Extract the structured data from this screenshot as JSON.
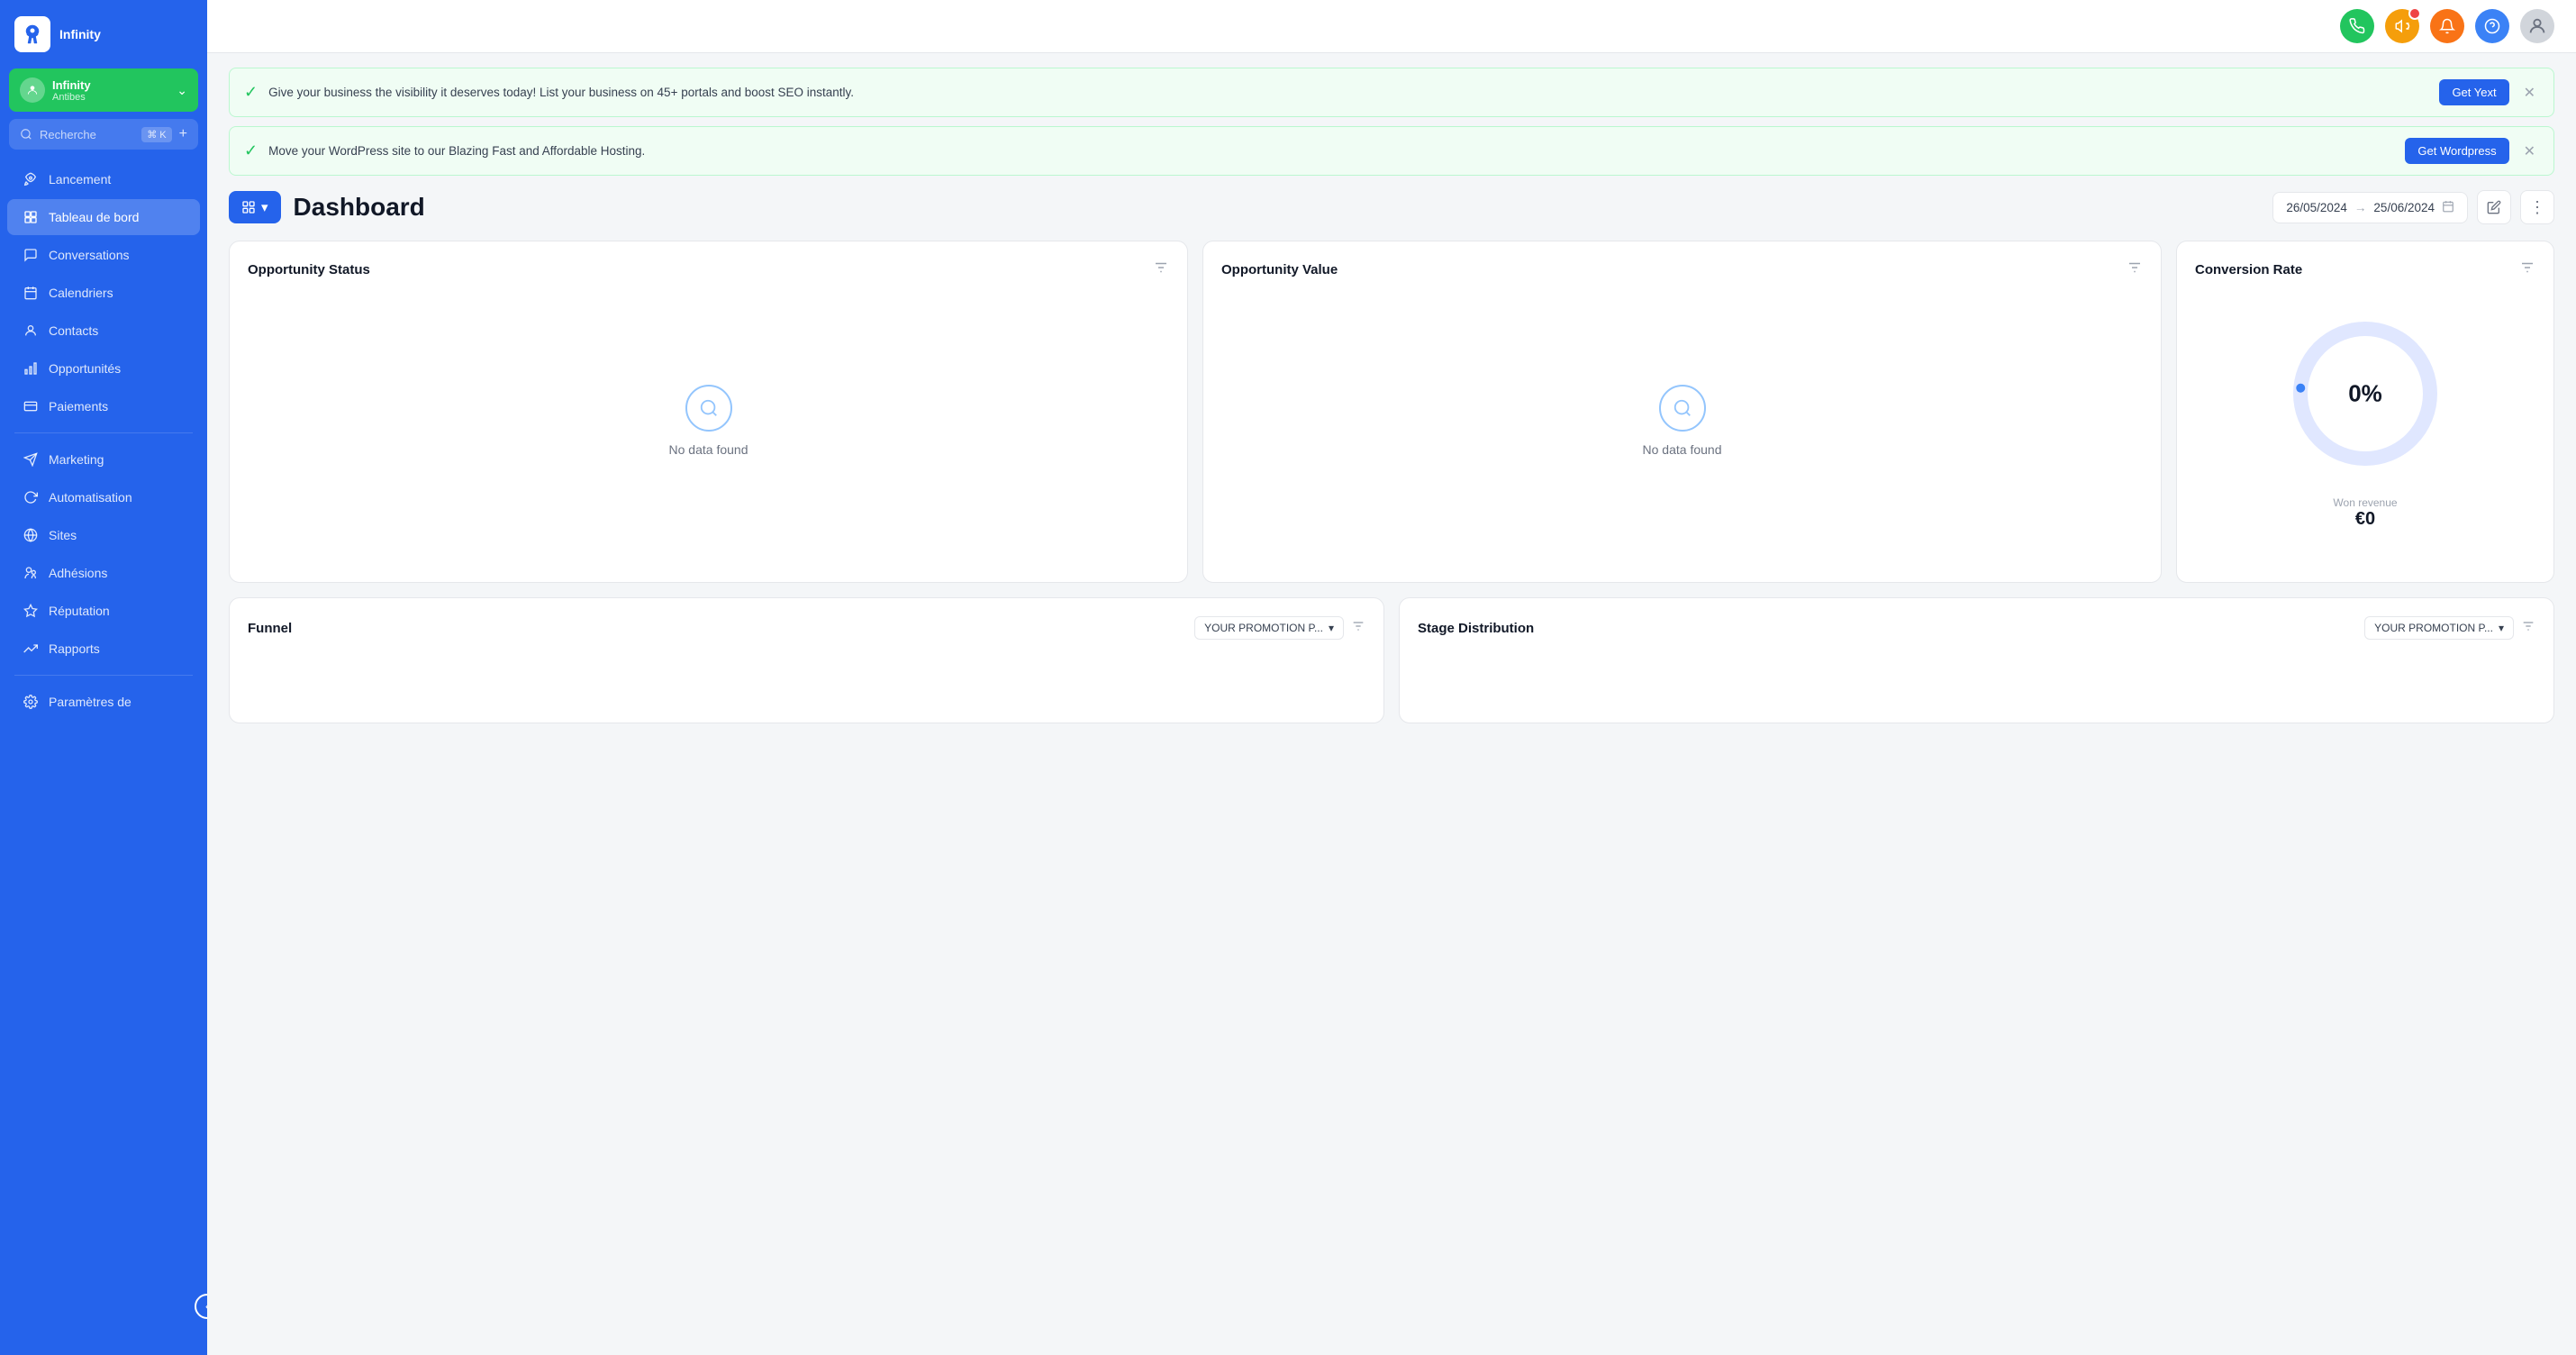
{
  "app": {
    "name": "Infinity",
    "logo_text": "INFINITY"
  },
  "user": {
    "name": "Infinity",
    "location": "Antibes"
  },
  "search": {
    "placeholder": "Recherche",
    "shortcut": "⌘ K"
  },
  "sidebar": {
    "nav_items": [
      {
        "id": "lancement",
        "label": "Lancement",
        "icon": "rocket"
      },
      {
        "id": "tableau-de-bord",
        "label": "Tableau de bord",
        "icon": "grid",
        "active": true
      },
      {
        "id": "conversations",
        "label": "Conversations",
        "icon": "chat"
      },
      {
        "id": "calendriers",
        "label": "Calendriers",
        "icon": "calendar"
      },
      {
        "id": "contacts",
        "label": "Contacts",
        "icon": "user"
      },
      {
        "id": "opportunites",
        "label": "Opportunités",
        "icon": "chart-bar"
      },
      {
        "id": "paiements",
        "label": "Paiements",
        "icon": "payment"
      },
      {
        "id": "marketing",
        "label": "Marketing",
        "icon": "send"
      },
      {
        "id": "automatisation",
        "label": "Automatisation",
        "icon": "refresh"
      },
      {
        "id": "sites",
        "label": "Sites",
        "icon": "globe"
      },
      {
        "id": "adhesions",
        "label": "Adhésions",
        "icon": "members"
      },
      {
        "id": "reputation",
        "label": "Réputation",
        "icon": "star"
      },
      {
        "id": "rapports",
        "label": "Rapports",
        "icon": "trending"
      },
      {
        "id": "parametres",
        "label": "Paramètres de",
        "icon": "settings"
      }
    ]
  },
  "banners": [
    {
      "id": "yext",
      "text": "Give your business the visibility it deserves today! List your business on 45+ portals and boost SEO instantly.",
      "button": "Get Yext"
    },
    {
      "id": "wordpress",
      "text": "Move your WordPress site to our Blazing Fast and Affordable Hosting.",
      "button": "Get Wordpress"
    }
  ],
  "dashboard": {
    "title": "Dashboard",
    "date_from": "26/05/2024",
    "date_to": "25/06/2024",
    "cards": [
      {
        "id": "opportunity-status",
        "title": "Opportunity Status",
        "no_data": "No data found"
      },
      {
        "id": "opportunity-value",
        "title": "Opportunity Value",
        "no_data": "No data found"
      },
      {
        "id": "conversion-rate",
        "title": "Conversion Rate",
        "percent": "0%",
        "won_revenue_label": "Won revenue",
        "won_revenue_value": "€0"
      }
    ],
    "bottom_cards": [
      {
        "id": "funnel",
        "title": "Funnel",
        "pipeline": "YOUR PROMOTION P..."
      },
      {
        "id": "stage-distribution",
        "title": "Stage Distribution",
        "pipeline": "YOUR PROMOTION P..."
      }
    ]
  }
}
